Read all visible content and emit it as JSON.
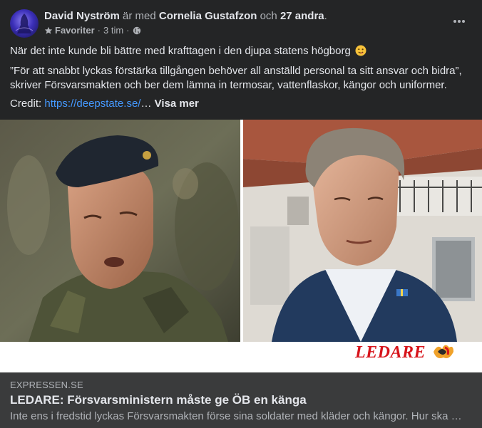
{
  "post": {
    "author": "David Nyström",
    "with_text": "är med",
    "tagged_person": "Cornelia Gustafzon",
    "and_text": "och",
    "others": "27 andra",
    "period": ".",
    "audience": "Favoriter",
    "dot": "·",
    "time": "3 tim",
    "privacy_icon": "globe-icon",
    "more_icon": "more-dots-icon"
  },
  "body": {
    "line1": "När det inte kunde bli bättre med krafttagen i den djupa statens högborg",
    "emoji": "wink-emoji",
    "quote": "”För att snabbt lyckas förstärka tillgången behöver all anställd personal ta sitt ansvar och bidra”, skriver Försvarsmakten och ber dem lämna in termosar, vattenflaskor, kängor och uniformer.",
    "credit_label": "Credit:",
    "credit_link": "https://deepstate.se/",
    "ellipsis": "…",
    "see_more": "Visa mer"
  },
  "image": {
    "logo_text": "LEDARE"
  },
  "preview": {
    "domain": "EXPRESSEN.SE",
    "title": "LEDARE: Försvarsministern måste ge ÖB en känga",
    "description": "Inte ens i fredstid lyckas Försvarsmakten förse sina soldater med kläder och kängor. Hur ska …"
  },
  "colors": {
    "background": "#242526",
    "preview_bg": "#3a3b3c",
    "link": "#4599ff",
    "ledare_red": "#d7141b"
  }
}
